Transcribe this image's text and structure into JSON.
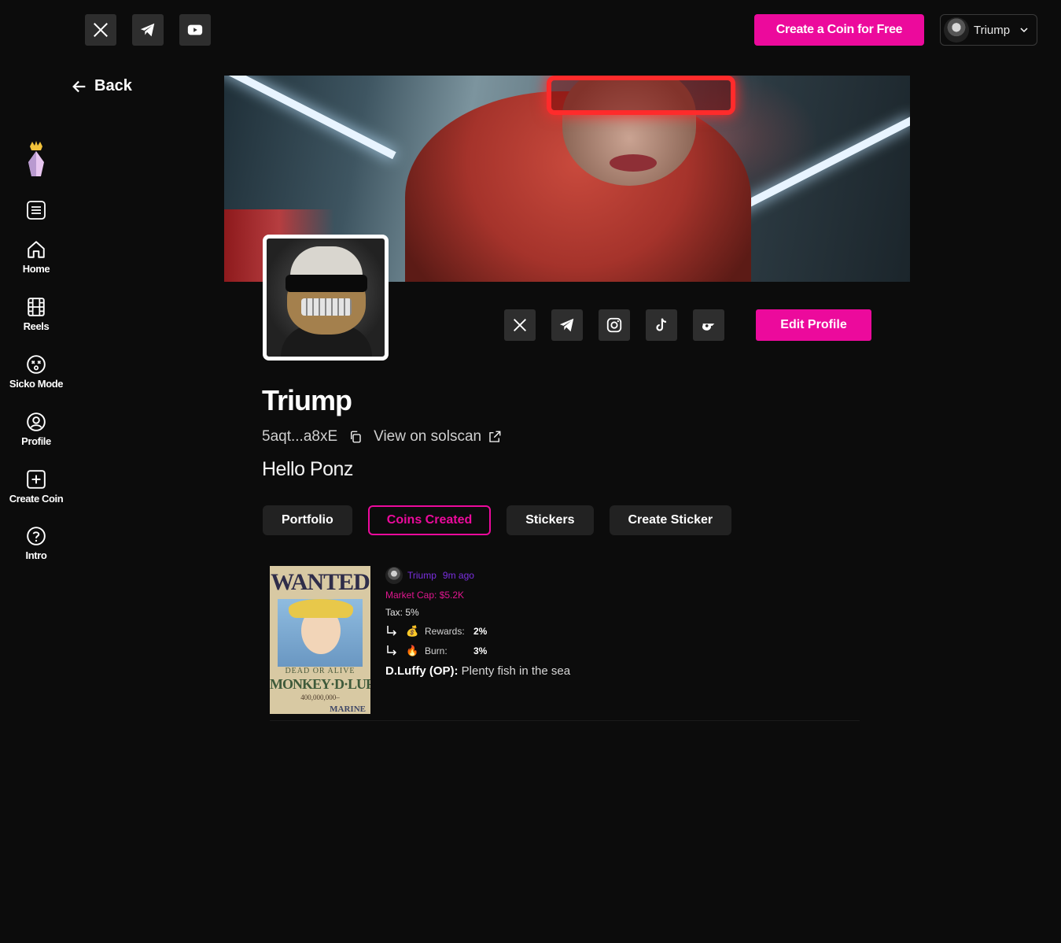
{
  "top_bar": {
    "create_coin_label": "Create a Coin for Free",
    "user_menu_name": "Triump"
  },
  "back_label": "Back",
  "sidebar": {
    "items": [
      {
        "label": "Home",
        "icon": "home-icon"
      },
      {
        "label": "Reels",
        "icon": "film-icon"
      },
      {
        "label": "Sicko Mode",
        "icon": "dizzy-face-icon"
      },
      {
        "label": "Profile",
        "icon": "user-circle-icon"
      },
      {
        "label": "Create Coin",
        "icon": "plus-square-icon"
      },
      {
        "label": "Intro",
        "icon": "help-circle-icon"
      }
    ]
  },
  "profile": {
    "name": "Triump",
    "address": "5aqt...a8xE",
    "solscan_label": "View on solscan",
    "bio": "Hello Ponz",
    "edit_label": "Edit Profile"
  },
  "tabs": [
    "Portfolio",
    "Coins Created",
    "Stickers",
    "Create Sticker"
  ],
  "active_tab": "Coins Created",
  "coin": {
    "poster": {
      "title": "WANTED",
      "subtitle": "DEAD OR ALIVE",
      "name": "MONKEY·D·LUFFY",
      "bounty": "400,000,000–",
      "marine": "MARINE"
    },
    "creator": "Triump",
    "time": "9m ago",
    "market_cap": "Market Cap: $5.2K",
    "tax": "Tax: 5%",
    "rewards_label": "Rewards:",
    "rewards_value": "2%",
    "burn_label": "Burn:",
    "burn_value": "3%",
    "desc_name": "D.Luffy (OP):",
    "desc_text": "Plenty fish in the sea"
  },
  "colors": {
    "accent": "#ec0a9c",
    "background": "#0c0c0c",
    "creator": "#7b2fe0"
  }
}
